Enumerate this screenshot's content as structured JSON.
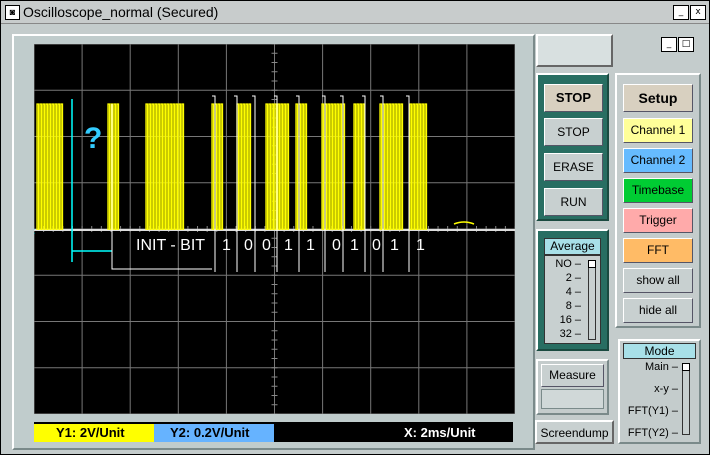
{
  "window": {
    "title": "Oscilloscope_normal (Secured)",
    "minimize_glyph": "_",
    "close_glyph": "x",
    "restore_glyph": "□"
  },
  "scope": {
    "question_mark": "?",
    "init_bit_label": "INIT - BIT",
    "bits": [
      "1",
      "0",
      "0",
      "1",
      "1",
      "0",
      "1",
      "0",
      "1",
      "1"
    ],
    "trace_color": "#ffff00",
    "ground_color": "#00ffff",
    "marker_symbol": "×"
  },
  "status": {
    "y1": "Y1: 2V/Unit",
    "y2": "Y2: 0.2V/Unit",
    "x": "X: 2ms/Unit"
  },
  "controls": {
    "stop_header": "STOP",
    "stop": "STOP",
    "erase": "ERASE",
    "run": "RUN"
  },
  "average": {
    "title": "Average",
    "options": [
      "NO",
      "2",
      "4",
      "8",
      "16",
      "32"
    ]
  },
  "setup": {
    "title": "Setup",
    "channel1": "Channel 1",
    "channel2": "Channel 2",
    "timebase": "Timebase",
    "trigger": "Trigger",
    "fft": "FFT",
    "show_all": "show all",
    "hide_all": "hide all"
  },
  "colors": {
    "channel1": "#ffff99",
    "channel2": "#66bbff",
    "timebase": "#00cc33",
    "trigger": "#ffaaaa",
    "fft": "#ffbb66",
    "y1_bg": "#ffff00",
    "y2_bg": "#66b3ff"
  },
  "measure": {
    "label": "Measure"
  },
  "screendump": {
    "label": "Screendump"
  },
  "mode": {
    "title": "Mode",
    "options": [
      "Main",
      "x-y",
      "FFT(Y1)",
      "FFT(Y2)"
    ]
  }
}
